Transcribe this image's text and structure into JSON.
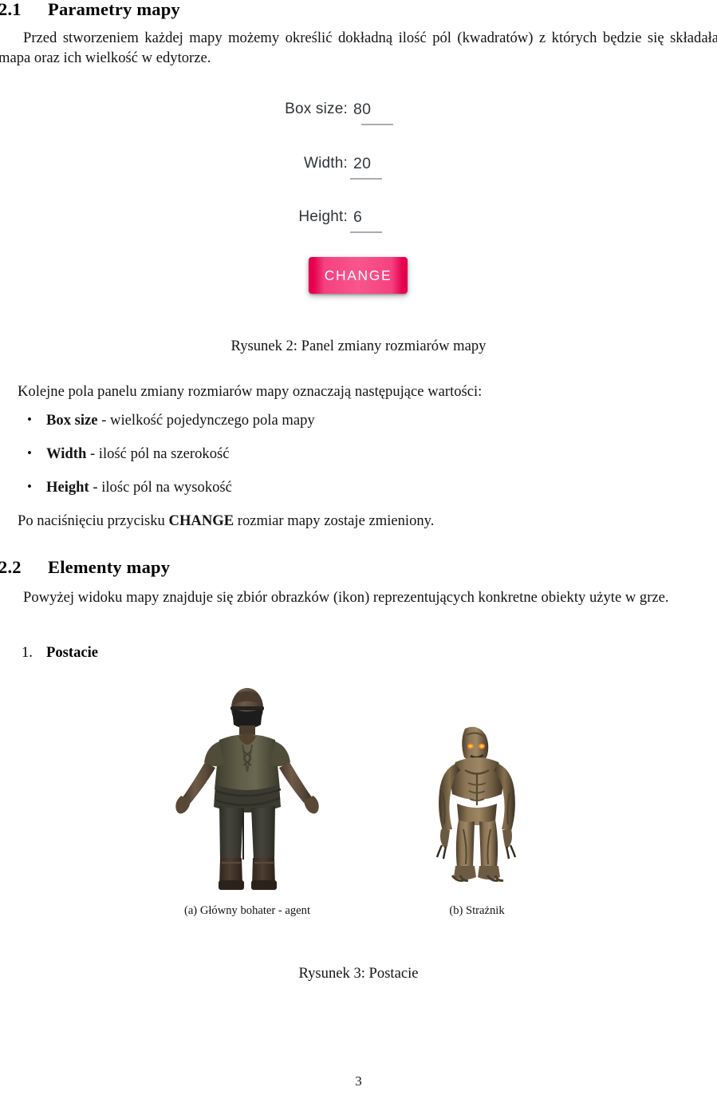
{
  "document": {
    "page_number": "3",
    "language": "pl"
  },
  "sections": {
    "parametry": {
      "number": "2.1",
      "title": "Parametry mapy",
      "intro": "Przed stworzeniem każdej mapy możemy określić dokładną ilość pól (kwadratów) z których będzie się składała mapa oraz ich wielkość w edytorze.",
      "fields_lead": "Kolejne pola panelu zmiany rozmiarów mapy oznaczają następujące wartości:",
      "bullets": [
        {
          "term": "Box size",
          "desc": " - wielkość pojedynczego pola mapy"
        },
        {
          "term": "Width",
          "desc": " - ilość pól na szerokość"
        },
        {
          "term": "Height",
          "desc": " - ilośc pól na wysokość"
        }
      ],
      "after_prefix": "Po naciśnięciu przycisku ",
      "after_bold": "CHANGE",
      "after_suffix": " rozmiar mapy zostaje zmieniony."
    },
    "elementy": {
      "number": "2.2",
      "title": "Elementy mapy",
      "intro": "Powyżej widoku mapy znajduje się zbiór obrazków (ikon) reprezentujących konkretne obiekty użyte w grze.",
      "items": [
        {
          "marker": "1.",
          "label": "Postacie"
        }
      ]
    }
  },
  "figure_panel": {
    "caption": "Rysunek 2: Panel zmiany rozmiarów mapy",
    "fields": [
      {
        "label": "Box size:",
        "value": "80"
      },
      {
        "label": "Width:",
        "value": "20"
      },
      {
        "label": "Height:",
        "value": "6"
      }
    ],
    "button": {
      "label": "CHANGE",
      "bg_edge_color": "#e6004f",
      "bg_center_color": "#f8568c",
      "text_color": "#ffffff"
    },
    "label_color": "#2f3438",
    "underline_color": "#a7adb3"
  },
  "figure_characters": {
    "caption": "Rysunek 3: Postacie",
    "items": [
      {
        "subcaption": "(a) Główny bohater - agent",
        "alt": "agent-character-render",
        "colors": {
          "skin": "#6b5443",
          "skin_shadow": "#4a392d",
          "tunic": "#55533f",
          "tunic_shadow": "#3e3c2e",
          "sash": "#3a3a31",
          "pants": "#3c3b34",
          "boots": "#4a3a2f",
          "mask": "#1b1b1b"
        }
      },
      {
        "subcaption": "(b) Strażnik",
        "alt": "guard-troll-character-render",
        "colors": {
          "body": "#8a7354",
          "body_shadow": "#4e4130",
          "body_light": "#a89074",
          "eye": "#ff8c1a",
          "claw": "#3a3025"
        }
      }
    ]
  }
}
